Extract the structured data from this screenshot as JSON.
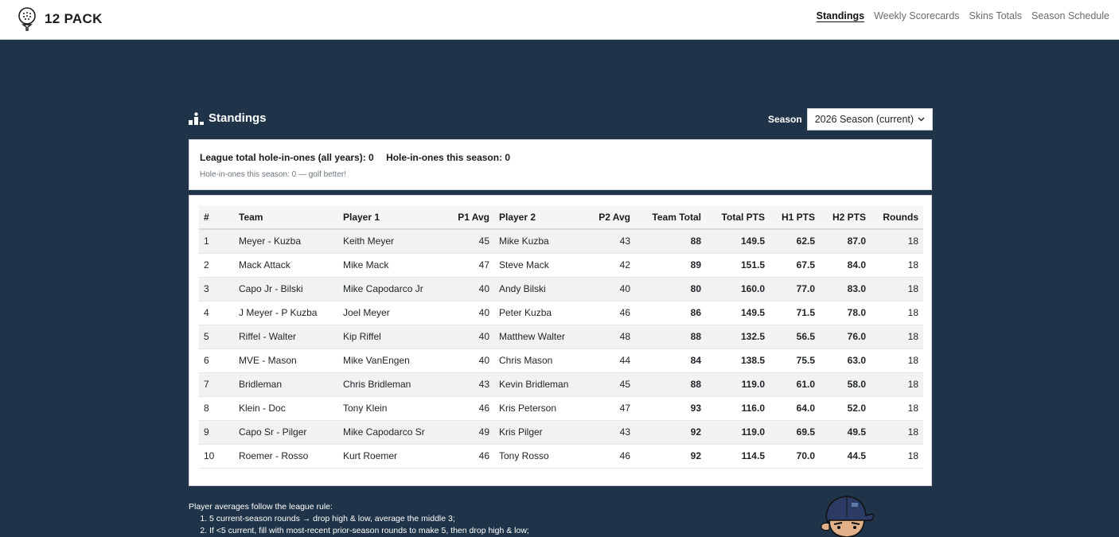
{
  "app": {
    "brand": "12 PACK",
    "brand_icon": "golf-ball-on-tee-icon"
  },
  "nav": {
    "items": [
      {
        "label": "Standings",
        "active": true
      },
      {
        "label": "Weekly Scorecards",
        "active": false
      },
      {
        "label": "Skins Totals",
        "active": false
      },
      {
        "label": "Season Schedule",
        "active": false
      }
    ]
  },
  "page": {
    "title": "Standings",
    "title_icon": "podium-icon"
  },
  "season": {
    "label": "Season",
    "selected": "2026 Season (current)"
  },
  "hole_in_ones": {
    "league_total": "League total hole-in-ones (all years): 0",
    "this_season": "Hole-in-ones this season: 0",
    "note": "Hole-in-ones this season: 0 — golf better!"
  },
  "table": {
    "headers": [
      "#",
      "Team",
      "Player 1",
      "P1 Avg",
      "Player 2",
      "P2 Avg",
      "Team Total",
      "Total PTS",
      "H1 PTS",
      "H2 PTS",
      "Rounds"
    ],
    "rows": [
      [
        "1",
        "Meyer - Kuzba",
        "Keith Meyer",
        "45",
        "Mike Kuzba",
        "43",
        "88",
        "149.5",
        "62.5",
        "87.0",
        "18"
      ],
      [
        "2",
        "Mack Attack",
        "Mike Mack",
        "47",
        "Steve Mack",
        "42",
        "89",
        "151.5",
        "67.5",
        "84.0",
        "18"
      ],
      [
        "3",
        "Capo Jr - Bilski",
        "Mike Capodarco Jr",
        "40",
        "Andy Bilski",
        "40",
        "80",
        "160.0",
        "77.0",
        "83.0",
        "18"
      ],
      [
        "4",
        "J Meyer - P Kuzba",
        "Joel Meyer",
        "40",
        "Peter Kuzba",
        "46",
        "86",
        "149.5",
        "71.5",
        "78.0",
        "18"
      ],
      [
        "5",
        "Riffel - Walter",
        "Kip Riffel",
        "40",
        "Matthew Walter",
        "48",
        "88",
        "132.5",
        "56.5",
        "76.0",
        "18"
      ],
      [
        "6",
        "MVE - Mason",
        "Mike VanEngen",
        "40",
        "Chris Mason",
        "44",
        "84",
        "138.5",
        "75.5",
        "63.0",
        "18"
      ],
      [
        "7",
        "Bridleman",
        "Chris Bridleman",
        "43",
        "Kevin Bridleman",
        "45",
        "88",
        "119.0",
        "61.0",
        "58.0",
        "18"
      ],
      [
        "8",
        "Klein - Doc",
        "Tony Klein",
        "46",
        "Kris Peterson",
        "47",
        "93",
        "116.0",
        "64.0",
        "52.0",
        "18"
      ],
      [
        "9",
        "Capo Sr - Pilger",
        "Mike Capodarco Sr",
        "49",
        "Kris Pilger",
        "43",
        "92",
        "119.0",
        "69.5",
        "49.5",
        "18"
      ],
      [
        "10",
        "Roemer - Rosso",
        "Kurt Roemer",
        "46",
        "Tony Rosso",
        "46",
        "92",
        "114.5",
        "70.0",
        "44.5",
        "18"
      ]
    ]
  },
  "notes": {
    "intro": "Player averages follow the league rule:",
    "items": [
      "5 current-season rounds → drop high & low, average the middle 3;",
      "If <5 current, fill with most-recent prior-season rounds to make 5, then drop high & low;"
    ]
  },
  "colors": {
    "page_background": "#1f3448",
    "card_background": "#ffffff",
    "row_stripe": "#f2f2f2"
  }
}
